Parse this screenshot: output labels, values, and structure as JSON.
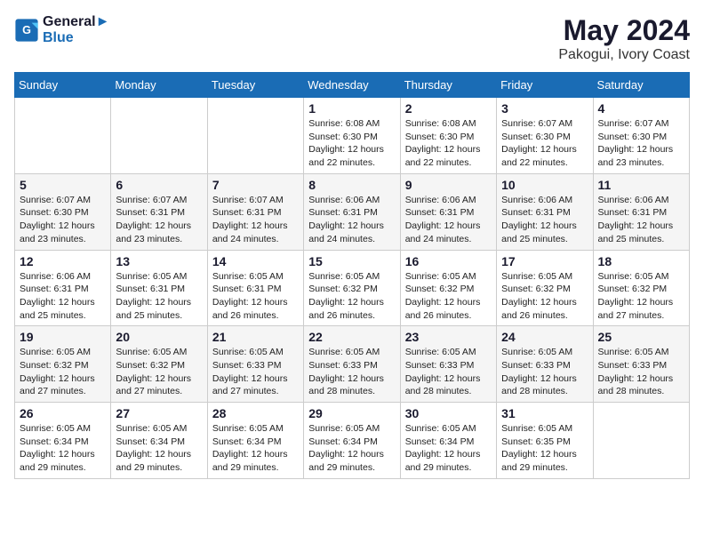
{
  "logo": {
    "line1": "General",
    "line2": "Blue"
  },
  "title": "May 2024",
  "location": "Pakogui, Ivory Coast",
  "days_of_week": [
    "Sunday",
    "Monday",
    "Tuesday",
    "Wednesday",
    "Thursday",
    "Friday",
    "Saturday"
  ],
  "weeks": [
    [
      {
        "day": "",
        "info": ""
      },
      {
        "day": "",
        "info": ""
      },
      {
        "day": "",
        "info": ""
      },
      {
        "day": "1",
        "sunrise": "6:08 AM",
        "sunset": "6:30 PM",
        "daylight": "12 hours and 22 minutes."
      },
      {
        "day": "2",
        "sunrise": "6:08 AM",
        "sunset": "6:30 PM",
        "daylight": "12 hours and 22 minutes."
      },
      {
        "day": "3",
        "sunrise": "6:07 AM",
        "sunset": "6:30 PM",
        "daylight": "12 hours and 22 minutes."
      },
      {
        "day": "4",
        "sunrise": "6:07 AM",
        "sunset": "6:30 PM",
        "daylight": "12 hours and 23 minutes."
      }
    ],
    [
      {
        "day": "5",
        "sunrise": "6:07 AM",
        "sunset": "6:30 PM",
        "daylight": "12 hours and 23 minutes."
      },
      {
        "day": "6",
        "sunrise": "6:07 AM",
        "sunset": "6:31 PM",
        "daylight": "12 hours and 23 minutes."
      },
      {
        "day": "7",
        "sunrise": "6:07 AM",
        "sunset": "6:31 PM",
        "daylight": "12 hours and 24 minutes."
      },
      {
        "day": "8",
        "sunrise": "6:06 AM",
        "sunset": "6:31 PM",
        "daylight": "12 hours and 24 minutes."
      },
      {
        "day": "9",
        "sunrise": "6:06 AM",
        "sunset": "6:31 PM",
        "daylight": "12 hours and 24 minutes."
      },
      {
        "day": "10",
        "sunrise": "6:06 AM",
        "sunset": "6:31 PM",
        "daylight": "12 hours and 25 minutes."
      },
      {
        "day": "11",
        "sunrise": "6:06 AM",
        "sunset": "6:31 PM",
        "daylight": "12 hours and 25 minutes."
      }
    ],
    [
      {
        "day": "12",
        "sunrise": "6:06 AM",
        "sunset": "6:31 PM",
        "daylight": "12 hours and 25 minutes."
      },
      {
        "day": "13",
        "sunrise": "6:05 AM",
        "sunset": "6:31 PM",
        "daylight": "12 hours and 25 minutes."
      },
      {
        "day": "14",
        "sunrise": "6:05 AM",
        "sunset": "6:31 PM",
        "daylight": "12 hours and 26 minutes."
      },
      {
        "day": "15",
        "sunrise": "6:05 AM",
        "sunset": "6:32 PM",
        "daylight": "12 hours and 26 minutes."
      },
      {
        "day": "16",
        "sunrise": "6:05 AM",
        "sunset": "6:32 PM",
        "daylight": "12 hours and 26 minutes."
      },
      {
        "day": "17",
        "sunrise": "6:05 AM",
        "sunset": "6:32 PM",
        "daylight": "12 hours and 26 minutes."
      },
      {
        "day": "18",
        "sunrise": "6:05 AM",
        "sunset": "6:32 PM",
        "daylight": "12 hours and 27 minutes."
      }
    ],
    [
      {
        "day": "19",
        "sunrise": "6:05 AM",
        "sunset": "6:32 PM",
        "daylight": "12 hours and 27 minutes."
      },
      {
        "day": "20",
        "sunrise": "6:05 AM",
        "sunset": "6:32 PM",
        "daylight": "12 hours and 27 minutes."
      },
      {
        "day": "21",
        "sunrise": "6:05 AM",
        "sunset": "6:33 PM",
        "daylight": "12 hours and 27 minutes."
      },
      {
        "day": "22",
        "sunrise": "6:05 AM",
        "sunset": "6:33 PM",
        "daylight": "12 hours and 28 minutes."
      },
      {
        "day": "23",
        "sunrise": "6:05 AM",
        "sunset": "6:33 PM",
        "daylight": "12 hours and 28 minutes."
      },
      {
        "day": "24",
        "sunrise": "6:05 AM",
        "sunset": "6:33 PM",
        "daylight": "12 hours and 28 minutes."
      },
      {
        "day": "25",
        "sunrise": "6:05 AM",
        "sunset": "6:33 PM",
        "daylight": "12 hours and 28 minutes."
      }
    ],
    [
      {
        "day": "26",
        "sunrise": "6:05 AM",
        "sunset": "6:34 PM",
        "daylight": "12 hours and 29 minutes."
      },
      {
        "day": "27",
        "sunrise": "6:05 AM",
        "sunset": "6:34 PM",
        "daylight": "12 hours and 29 minutes."
      },
      {
        "day": "28",
        "sunrise": "6:05 AM",
        "sunset": "6:34 PM",
        "daylight": "12 hours and 29 minutes."
      },
      {
        "day": "29",
        "sunrise": "6:05 AM",
        "sunset": "6:34 PM",
        "daylight": "12 hours and 29 minutes."
      },
      {
        "day": "30",
        "sunrise": "6:05 AM",
        "sunset": "6:34 PM",
        "daylight": "12 hours and 29 minutes."
      },
      {
        "day": "31",
        "sunrise": "6:05 AM",
        "sunset": "6:35 PM",
        "daylight": "12 hours and 29 minutes."
      },
      {
        "day": "",
        "info": ""
      }
    ]
  ],
  "labels": {
    "sunrise": "Sunrise:",
    "sunset": "Sunset:",
    "daylight": "Daylight:"
  }
}
